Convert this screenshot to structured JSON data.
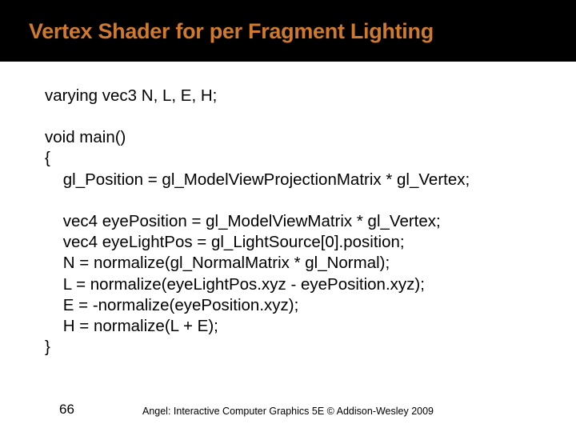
{
  "title": "Vertex Shader for per Fragment Lighting",
  "code": {
    "l0": "varying vec3 N, L, E, H;",
    "l1": "void main()",
    "l2": "{",
    "l3": "    gl_Position = gl_ModelViewProjectionMatrix * gl_Vertex;",
    "l4": "    vec4 eyePosition = gl_ModelViewMatrix * gl_Vertex;",
    "l5": "    vec4 eyeLightPos = gl_LightSource[0].position;",
    "l6": "    N = normalize(gl_NormalMatrix * gl_Normal);",
    "l7": "    L = normalize(eyeLightPos.xyz - eyePosition.xyz);",
    "l8": "    E = -normalize(eyePosition.xyz);",
    "l9": "    H = normalize(L + E);",
    "l10": "}"
  },
  "page_number": "66",
  "footer": "Angel: Interactive Computer Graphics 5E © Addison-Wesley 2009"
}
